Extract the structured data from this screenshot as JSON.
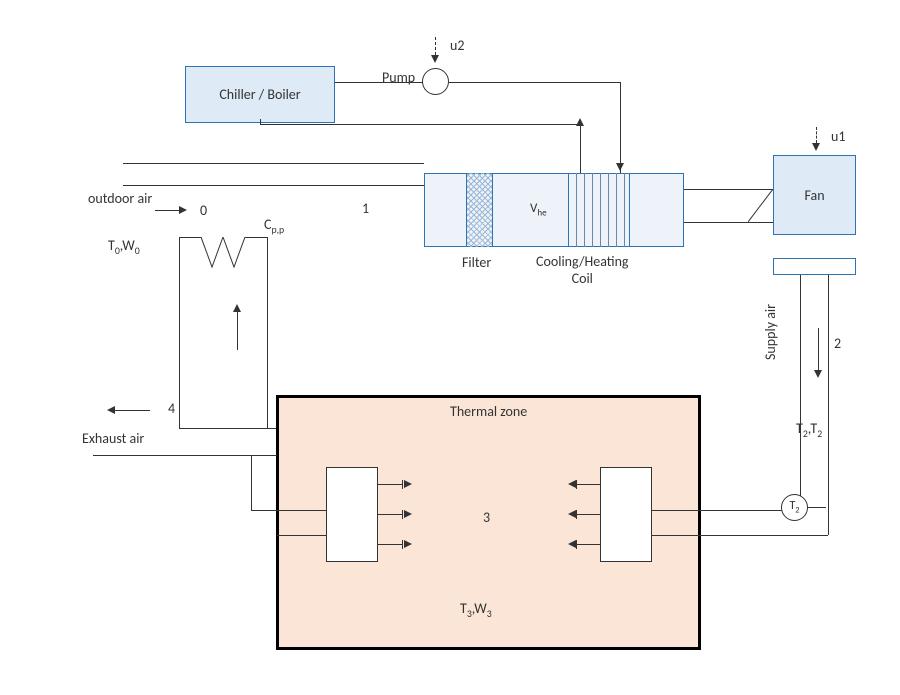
{
  "blocks": {
    "chiller": "Chiller / Boiler",
    "pump": "Pump",
    "fan": "Fan",
    "vhe": "Vhe",
    "filter": "Filter",
    "coil": "Cooling/Heating\nCoil",
    "zone": "Thermal zone"
  },
  "labels": {
    "outdoor_air": "outdoor air",
    "exhaust_air": "Exhaust air",
    "supply_air": "Supply air",
    "cpp": "Cp,p",
    "t0w0": "T0,W0",
    "t2t2": "T2,T2",
    "t3w3": "T3,W3",
    "u1": "u1",
    "u2": "u2",
    "sensor_t2": "T2"
  },
  "nodes": {
    "n0": "0",
    "n1": "1",
    "n2": "2",
    "n3": "3",
    "n4": "4"
  }
}
